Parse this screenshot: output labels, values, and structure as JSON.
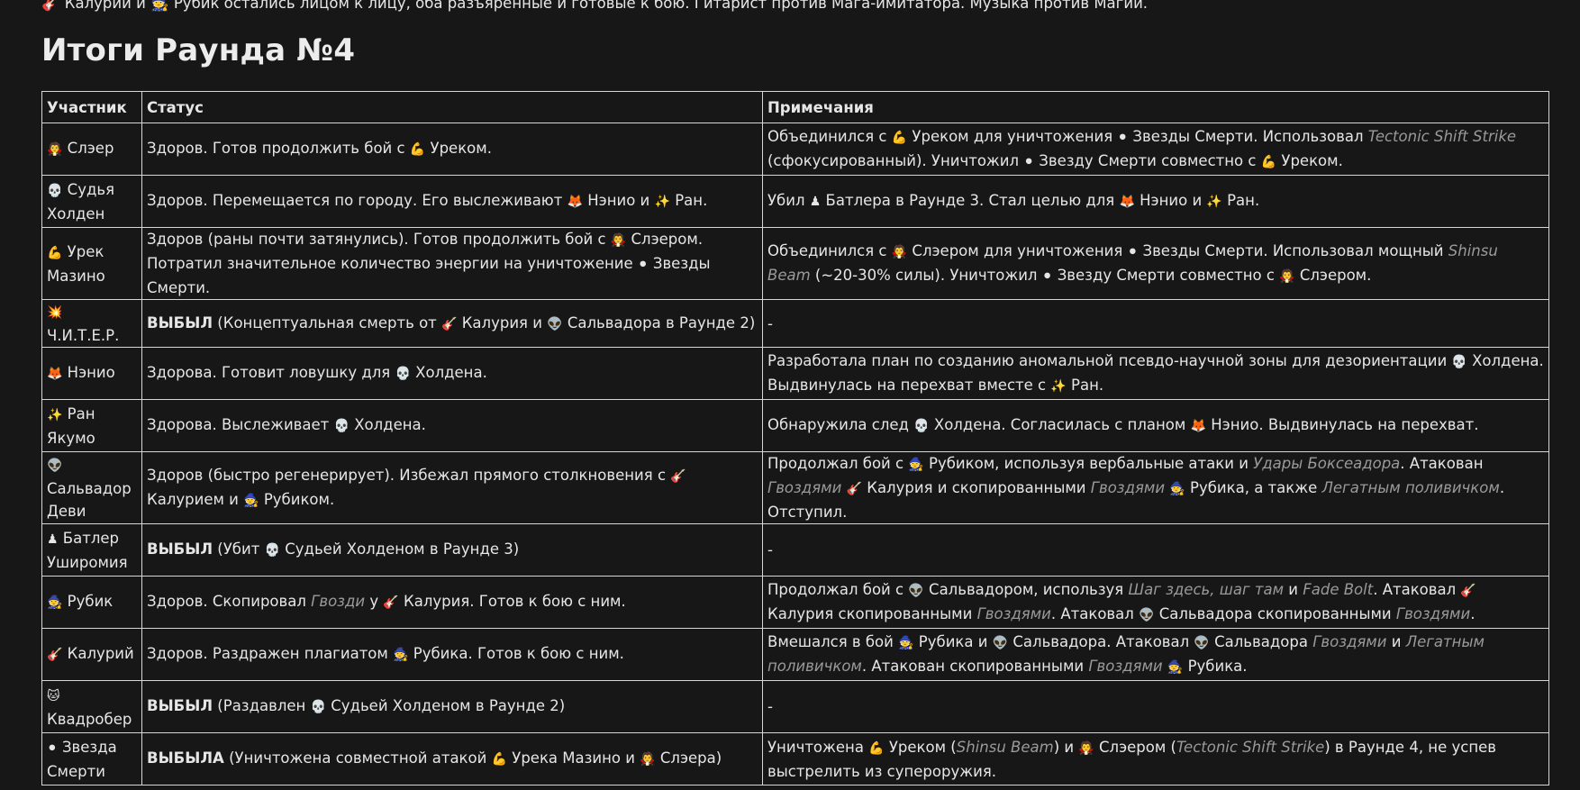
{
  "intro_text": "🎸 Калурии и 🧙 Рубик остались лицом к лицу, оба разъяренные и готовые к бою. Гитарист против Мага-имитатора. Музыка против Магии.",
  "heading": "Итоги Раунда №4",
  "table": {
    "headers": [
      "Участник",
      "Статус",
      "Примечания"
    ],
    "rows": [
      {
        "participant": [
          {
            "t": "🧛",
            "e": 1
          },
          {
            "t": " Слэер"
          }
        ],
        "status": [
          {
            "t": "Здоров. Готов продолжить бой с "
          },
          {
            "t": "💪",
            "e": 1
          },
          {
            "t": " Уреком."
          }
        ],
        "notes": [
          {
            "t": "Объединился с "
          },
          {
            "t": "💪",
            "e": 1
          },
          {
            "t": " Уреком для уничтожения "
          },
          {
            "t": "⚫",
            "e": 1
          },
          {
            "t": " Звезды Смерти. Использовал "
          },
          {
            "t": "Tectonic Shift Strike",
            "i": 1
          },
          {
            "t": " (сфокусированный). Уничтожил "
          },
          {
            "t": "⚫",
            "e": 1
          },
          {
            "t": " Звезду Смерти совместно с "
          },
          {
            "t": "💪",
            "e": 1
          },
          {
            "t": " Уреком."
          }
        ]
      },
      {
        "participant": [
          {
            "t": "💀",
            "e": 1
          },
          {
            "t": " Судья Холден"
          }
        ],
        "status": [
          {
            "t": "Здоров. Перемещается по городу. Его выслеживают "
          },
          {
            "t": "🦊",
            "e": 1
          },
          {
            "t": " Нэнио и "
          },
          {
            "t": "✨",
            "e": 1
          },
          {
            "t": " Ран."
          }
        ],
        "notes": [
          {
            "t": "Убил "
          },
          {
            "t": "♟",
            "e": 1
          },
          {
            "t": " Батлера в Раунде 3. Стал целью для "
          },
          {
            "t": "🦊",
            "e": 1
          },
          {
            "t": " Нэнио и "
          },
          {
            "t": "✨",
            "e": 1
          },
          {
            "t": " Ран."
          }
        ]
      },
      {
        "participant": [
          {
            "t": "💪",
            "e": 1
          },
          {
            "t": " Урек Мазино"
          }
        ],
        "status": [
          {
            "t": "Здоров (раны почти затянулись). Готов продолжить бой с "
          },
          {
            "t": "🧛",
            "e": 1
          },
          {
            "t": " Слэером. Потратил значительное количество энергии на уничтожение "
          },
          {
            "t": "⚫",
            "e": 1
          },
          {
            "t": " Звезды Смерти."
          }
        ],
        "notes": [
          {
            "t": "Объединился с "
          },
          {
            "t": "🧛",
            "e": 1
          },
          {
            "t": " Слэером для уничтожения "
          },
          {
            "t": "⚫",
            "e": 1
          },
          {
            "t": " Звезды Смерти. Использовал мощный "
          },
          {
            "t": "Shinsu Beam",
            "i": 1
          },
          {
            "t": " (~20-30% силы). Уничтожил "
          },
          {
            "t": "⚫",
            "e": 1
          },
          {
            "t": " Звезду Смерти совместно с "
          },
          {
            "t": "🧛",
            "e": 1
          },
          {
            "t": " Слэером."
          }
        ]
      },
      {
        "short": true,
        "participant": [
          {
            "t": "💥",
            "e": 1
          },
          {
            "t": " Ч.И.Т.Е.Р."
          }
        ],
        "status": [
          {
            "t": "ВЫБЫЛ",
            "b": 1
          },
          {
            "t": " (Концептуальная смерть от "
          },
          {
            "t": "🎸",
            "e": 1
          },
          {
            "t": " Калурия и "
          },
          {
            "t": "👽",
            "e": 1
          },
          {
            "t": " Сальвадора в Раунде 2)"
          }
        ],
        "notes": [
          {
            "t": "-"
          }
        ]
      },
      {
        "participant": [
          {
            "t": "🦊",
            "e": 1
          },
          {
            "t": " Нэнио"
          }
        ],
        "status": [
          {
            "t": "Здорова. Готовит ловушку для "
          },
          {
            "t": "💀",
            "e": 1
          },
          {
            "t": " Холдена."
          }
        ],
        "notes": [
          {
            "t": "Разработала план по созданию аномальной псевдо-научной зоны для дезориентации "
          },
          {
            "t": "💀",
            "e": 1
          },
          {
            "t": " Холдена. Выдвинулась на перехват вместе с "
          },
          {
            "t": "✨",
            "e": 1
          },
          {
            "t": " Ран."
          }
        ]
      },
      {
        "participant": [
          {
            "t": "✨",
            "e": 1
          },
          {
            "t": " Ран Якумо"
          }
        ],
        "status": [
          {
            "t": "Здорова. Выслеживает "
          },
          {
            "t": "💀",
            "e": 1
          },
          {
            "t": " Холдена."
          }
        ],
        "notes": [
          {
            "t": "Обнаружила след "
          },
          {
            "t": "💀",
            "e": 1
          },
          {
            "t": " Холдена. Согласилась с планом "
          },
          {
            "t": "🦊",
            "e": 1
          },
          {
            "t": " Нэнио. Выдвинулась на перехват."
          }
        ]
      },
      {
        "participant": [
          {
            "t": "👽",
            "e": 1
          },
          {
            "t": " Сальвадор Деви"
          }
        ],
        "status": [
          {
            "t": "Здоров (быстро регенерирует). Избежал прямого столкновения с "
          },
          {
            "t": "🎸",
            "e": 1
          },
          {
            "t": " Калурием и "
          },
          {
            "t": "🧙",
            "e": 1
          },
          {
            "t": " Рубиком."
          }
        ],
        "notes": [
          {
            "t": "Продолжал бой с "
          },
          {
            "t": "🧙",
            "e": 1
          },
          {
            "t": " Рубиком, используя вербальные атаки и "
          },
          {
            "t": "Удары Боксеадора",
            "i": 1
          },
          {
            "t": ". Атакован "
          },
          {
            "t": "Гвоздями",
            "i": 1
          },
          {
            "t": " "
          },
          {
            "t": "🎸",
            "e": 1
          },
          {
            "t": " Калурия и скопированными "
          },
          {
            "t": "Гвоздями",
            "i": 1
          },
          {
            "t": " "
          },
          {
            "t": "🧙",
            "e": 1
          },
          {
            "t": " Рубика, а также "
          },
          {
            "t": "Легатным поливичком",
            "i": 1
          },
          {
            "t": ". Отступил."
          }
        ]
      },
      {
        "participant": [
          {
            "t": "♟",
            "e": 1
          },
          {
            "t": " Батлер Уширомия"
          }
        ],
        "status": [
          {
            "t": "ВЫБЫЛ",
            "b": 1
          },
          {
            "t": " (Убит "
          },
          {
            "t": "💀",
            "e": 1
          },
          {
            "t": " Судьей Холденом в Раунде 3)"
          }
        ],
        "notes": [
          {
            "t": "-"
          }
        ]
      },
      {
        "participant": [
          {
            "t": "🧙",
            "e": 1
          },
          {
            "t": " Рубик"
          }
        ],
        "status": [
          {
            "t": "Здоров. Скопировал "
          },
          {
            "t": "Гвозди",
            "i": 1
          },
          {
            "t": " у "
          },
          {
            "t": "🎸",
            "e": 1
          },
          {
            "t": " Калурия. Готов к бою с ним."
          }
        ],
        "notes": [
          {
            "t": "Продолжал бой с "
          },
          {
            "t": "👽",
            "e": 1
          },
          {
            "t": " Сальвадором, используя "
          },
          {
            "t": "Шаг здесь, шаг там",
            "i": 1
          },
          {
            "t": " и "
          },
          {
            "t": "Fade Bolt",
            "i": 1
          },
          {
            "t": ". Атаковал "
          },
          {
            "t": "🎸",
            "e": 1
          },
          {
            "t": " Калурия скопированными "
          },
          {
            "t": "Гвоздями",
            "i": 1
          },
          {
            "t": ". Атаковал "
          },
          {
            "t": "👽",
            "e": 1
          },
          {
            "t": " Сальвадора скопированными "
          },
          {
            "t": "Гвоздями",
            "i": 1
          },
          {
            "t": "."
          }
        ]
      },
      {
        "participant": [
          {
            "t": "🎸",
            "e": 1
          },
          {
            "t": " Калурий"
          }
        ],
        "status": [
          {
            "t": "Здоров. Раздражен плагиатом "
          },
          {
            "t": "🧙",
            "e": 1
          },
          {
            "t": " Рубика. Готов к бою с ним."
          }
        ],
        "notes": [
          {
            "t": "Вмешался в бой "
          },
          {
            "t": "🧙",
            "e": 1
          },
          {
            "t": " Рубика и "
          },
          {
            "t": "👽",
            "e": 1
          },
          {
            "t": " Сальвадора. Атаковал "
          },
          {
            "t": "👽",
            "e": 1
          },
          {
            "t": " Сальвадора "
          },
          {
            "t": "Гвоздями",
            "i": 1
          },
          {
            "t": " и "
          },
          {
            "t": "Легатным поливичком",
            "i": 1
          },
          {
            "t": ". Атакован скопированными "
          },
          {
            "t": "Гвоздями",
            "i": 1
          },
          {
            "t": " "
          },
          {
            "t": "🧙",
            "e": 1
          },
          {
            "t": " Рубика."
          }
        ]
      },
      {
        "participant": [
          {
            "t": "🐱",
            "e": 1
          },
          {
            "t": " Квадробер"
          }
        ],
        "status": [
          {
            "t": "ВЫБЫЛ",
            "b": 1
          },
          {
            "t": " (Раздавлен "
          },
          {
            "t": "💀",
            "e": 1
          },
          {
            "t": " Судьей Холденом в Раунде 2)"
          }
        ],
        "notes": [
          {
            "t": "-"
          }
        ]
      },
      {
        "participant": [
          {
            "t": "⚫",
            "e": 1
          },
          {
            "t": " Звезда Смерти"
          }
        ],
        "status": [
          {
            "t": "ВЫБЫЛА",
            "b": 1
          },
          {
            "t": " (Уничтожена совместной атакой "
          },
          {
            "t": "💪",
            "e": 1
          },
          {
            "t": " Урека Мазино и "
          },
          {
            "t": "🧛",
            "e": 1
          },
          {
            "t": " Слэера)"
          }
        ],
        "notes": [
          {
            "t": "Уничтожена "
          },
          {
            "t": "💪",
            "e": 1
          },
          {
            "t": " Уреком ("
          },
          {
            "t": "Shinsu Beam",
            "i": 1
          },
          {
            "t": ") и "
          },
          {
            "t": "🧛",
            "e": 1
          },
          {
            "t": " Слэером ("
          },
          {
            "t": "Tectonic Shift Strike",
            "i": 1
          },
          {
            "t": ") в Раунде 4, не успев выстрелить из супероружия."
          }
        ]
      }
    ]
  }
}
